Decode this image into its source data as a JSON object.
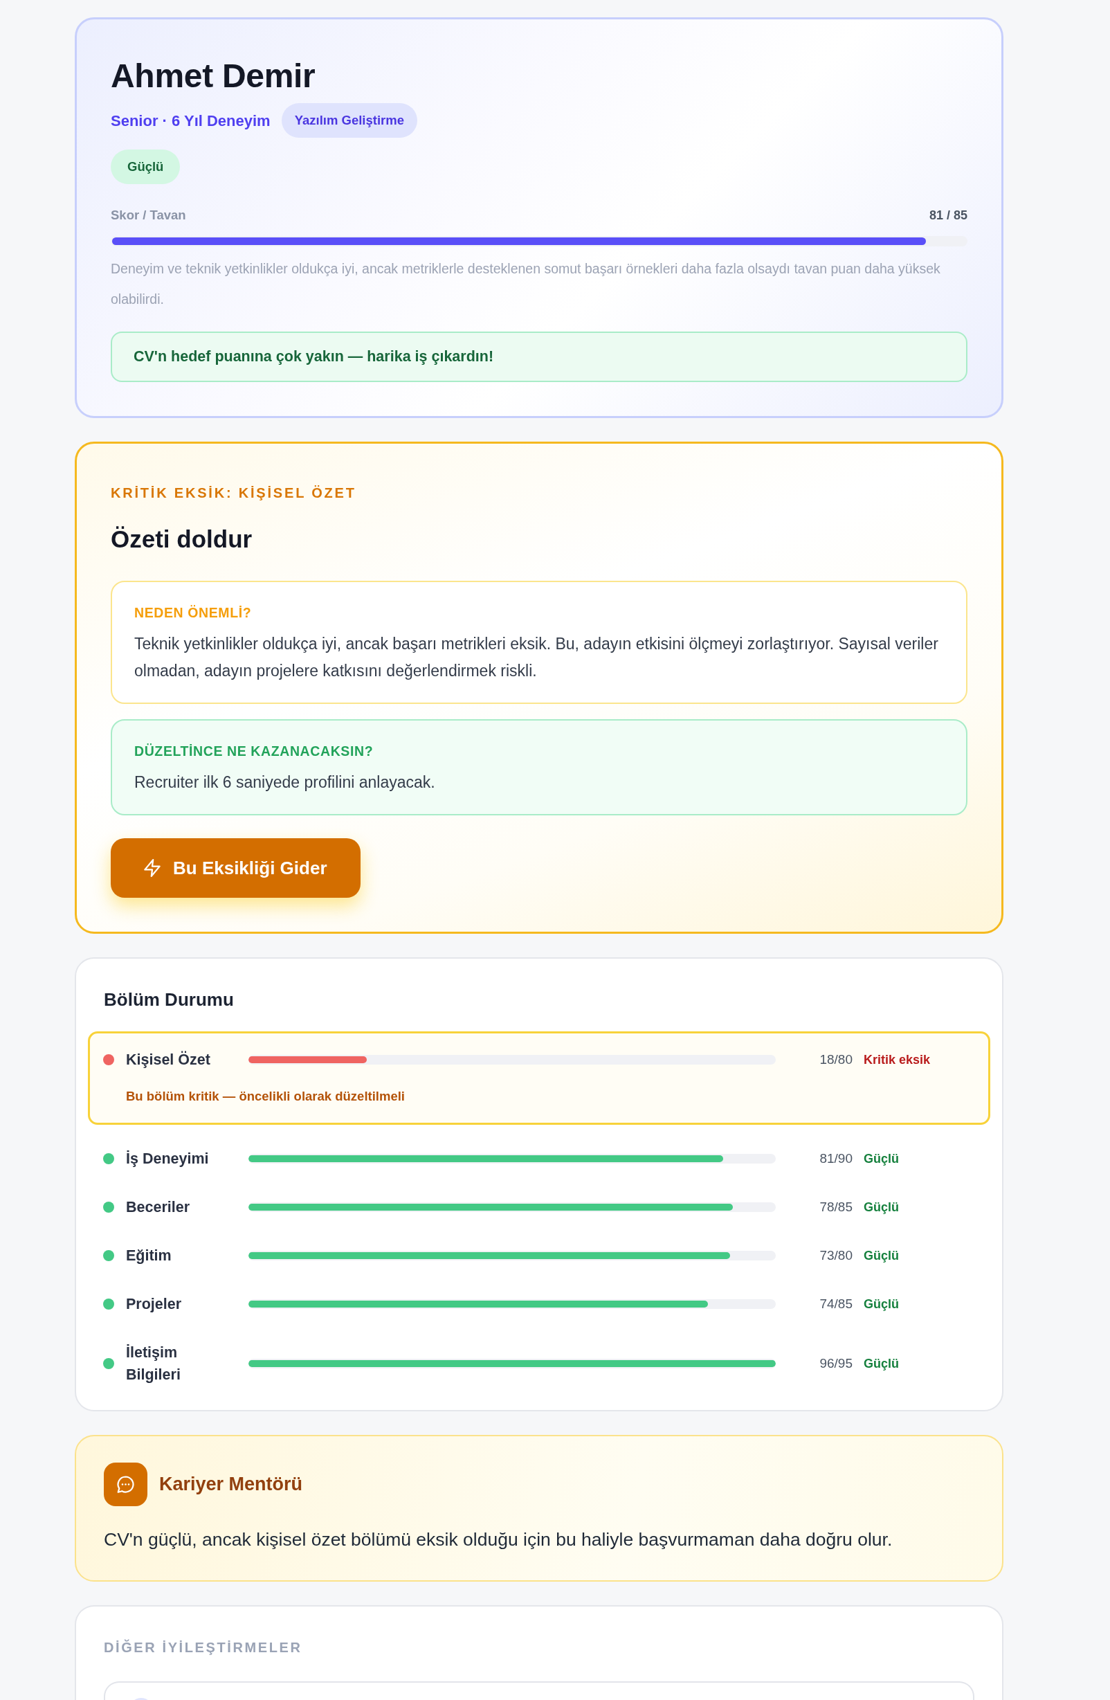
{
  "profile": {
    "name": "Ahmet Demir",
    "subtitle": "Senior · 6 Yıl Deneyim",
    "field_badge": "Yazılım Geliştirme",
    "rating_badge": "Güçlü",
    "score_label": "Skor / Tavan",
    "score": "81 / 85",
    "level": 0.953,
    "description": "Deneyim ve teknik yetkinlikler oldukça iyi, ancak metriklerle desteklenen somut başarı örnekleri daha fazla olsaydı tavan puan daha yüksek olabilirdi.",
    "message": "CV'n hedef puanına çok yakın — harika iş çıkardın!"
  },
  "critical_gap": {
    "eyebrow": "KRİTİK EKSİK: KİŞİSEL ÖZET",
    "title": "Özeti doldur",
    "panels": [
      {
        "kind": "why",
        "label": "NEDEN ÖNEMLİ?",
        "text": "Teknik yetkinlikler oldukça iyi, ancak başarı metrikleri eksik. Bu, adayın etkisini ölçmeyi zorlaştırıyor. Sayısal veriler olmadan, adayın projelere katkısını değerlendirmek riskli."
      },
      {
        "kind": "gain",
        "label": "DÜZELTİNCE NE KAZANACAKSIN?",
        "text": "Recruiter ilk 6 saniyede profilini anlayacak."
      }
    ],
    "button": "Bu Eksikliği Gider"
  },
  "section_status": {
    "title": "Bölüm Durumu",
    "sections": [
      {
        "kind": "critical",
        "name": "Kişisel Özet",
        "color": "#ef6461",
        "level": 0.225,
        "score": "18/80",
        "status": "Kritik eksik",
        "note": "Bu bölüm kritik — öncelikli olarak düzeltilmeli"
      },
      {
        "kind": "strong",
        "name": "İş Deneyimi",
        "color": "#43c985",
        "level": 0.9,
        "score": "81/90",
        "status": "Güçlü"
      },
      {
        "kind": "strong",
        "name": "Beceriler",
        "color": "#43c985",
        "level": 0.918,
        "score": "78/85",
        "status": "Güçlü"
      },
      {
        "kind": "strong",
        "name": "Eğitim",
        "color": "#43c985",
        "level": 0.913,
        "score": "73/80",
        "status": "Güçlü"
      },
      {
        "kind": "strong",
        "name": "Projeler",
        "color": "#43c985",
        "level": 0.871,
        "score": "74/85",
        "status": "Güçlü"
      },
      {
        "kind": "strong",
        "name": "İletişim Bilgileri",
        "color": "#43c985",
        "level": 1,
        "score": "96/95",
        "status": "Güçlü"
      }
    ]
  },
  "mentor": {
    "title": "Kariyer Mentörü",
    "text": "CV'n güçlü, ancak kişisel özet bölümü eksik olduğu için bu haliyle başvurmaman daha doğru olur."
  },
  "other_improvements": {
    "title": "DİĞER İYİLEŞTİRMELER",
    "items": [
      {
        "kind": "improvement"
      }
    ]
  }
}
